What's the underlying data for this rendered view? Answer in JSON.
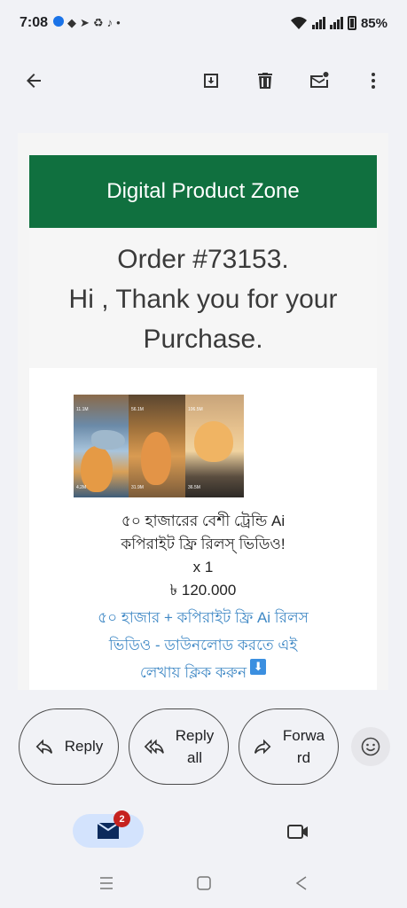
{
  "status": {
    "time": "7:08",
    "notification_icons": [
      "messenger-icon",
      "chat-icon",
      "telegram-icon",
      "sync-icon",
      "tiktok-icon"
    ],
    "dot": "•",
    "battery": "85%"
  },
  "toolbar": {
    "back": "back-arrow-icon",
    "archive": "archive-icon",
    "delete": "trash-icon",
    "mark_unread": "mark-unread-icon",
    "more": "more-vert-icon"
  },
  "email": {
    "brand_header": "Digital Product Zone",
    "order_line": "Order #73153.",
    "thanks_line1": "Hi , Thank you for your",
    "thanks_line2": "Purchase.",
    "product": {
      "title_line1": "৫০ হাজারের বেশী ট্রেন্ডি Ai",
      "title_line2": "কপিরাইট ফ্রি রিলস্ ভিডিও!",
      "qty": "x 1",
      "price": "৳ 120.000",
      "link_line1": "৫০ হাজার + কপিরাইট ফ্রি Ai রিলস",
      "link_line2": "ভিডিও - ডাউনলোড করতে এই",
      "link_line3": "লেখায় ক্লিক করুন",
      "download_badge": "⬇",
      "thumb_labels": [
        "11.1M",
        "56.1M",
        "106.5M",
        "4.2M",
        "31.9M",
        "36.5M"
      ]
    }
  },
  "actions": {
    "reply": "Reply",
    "reply_all_line1": "Reply",
    "reply_all_line2": "all",
    "forward_line1": "Forwa",
    "forward_line2": "rd",
    "emoji": "emoji-icon"
  },
  "bottom_nav": {
    "mail_badge": "2",
    "mail": "mail-icon",
    "meet": "video-icon"
  },
  "colors": {
    "header_green": "#10703f",
    "link_blue": "#3f88c5",
    "badge_red": "#c5221f",
    "active_pill": "#d3e3fd"
  }
}
